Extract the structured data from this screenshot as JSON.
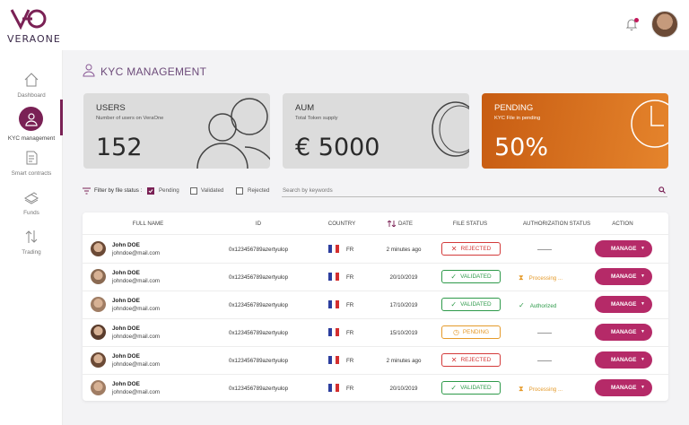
{
  "brand": {
    "name": "VERAONE",
    "accent": "#7a2155"
  },
  "sidebar": {
    "items": [
      {
        "label": "Dashboard",
        "icon": "home-icon"
      },
      {
        "label": "KYC management",
        "icon": "user-icon",
        "active": true
      },
      {
        "label": "Smart contracts",
        "icon": "document-icon"
      },
      {
        "label": "Funds",
        "icon": "funds-icon"
      },
      {
        "label": "Trading",
        "icon": "trading-icon"
      }
    ]
  },
  "page": {
    "title": "KYC MANAGEMENT"
  },
  "cards": [
    {
      "title": "USERS",
      "subtitle": "Number of users on VeraOne",
      "value": "152"
    },
    {
      "title": "AUM",
      "subtitle": "Total Token supply",
      "value": "€ 5000"
    },
    {
      "title": "PENDING",
      "subtitle": "KYC File in pending",
      "value": "50%"
    }
  ],
  "filter": {
    "label": "Filter by file status :",
    "options": [
      {
        "label": "Pending",
        "checked": true
      },
      {
        "label": "Validated",
        "checked": false
      },
      {
        "label": "Rejected",
        "checked": false
      }
    ],
    "search_placeholder": "Search by keywords"
  },
  "table": {
    "headers": [
      "FULL NAME",
      "ID",
      "COUNTRY",
      "DATE",
      "FILE STATUS",
      "AUTHORIZATION STATUS",
      "ACTION"
    ],
    "rows": [
      {
        "name": "John DOE",
        "email": "johndoe@mail.com",
        "id": "0x123456789azertyulop",
        "country": "FR",
        "date": "2 minutes ago",
        "status": "REJECTED",
        "auth": ""
      },
      {
        "name": "John DOE",
        "email": "johndoe@mail.com",
        "id": "0x123456789azertyulop",
        "country": "FR",
        "date": "20/10/2019",
        "status": "VALIDATED",
        "auth": "Processing ..."
      },
      {
        "name": "John DOE",
        "email": "johndoe@mail.com",
        "id": "0x123456789azertyulop",
        "country": "FR",
        "date": "17/10/2019",
        "status": "VALIDATED",
        "auth": "Authorized"
      },
      {
        "name": "John DOE",
        "email": "johndoe@mail.com",
        "id": "0x123456789azertyulop",
        "country": "FR",
        "date": "15/10/2019",
        "status": "PENDING",
        "auth": ""
      },
      {
        "name": "John DOE",
        "email": "johndoe@mail.com",
        "id": "0x123456789azertyulop",
        "country": "FR",
        "date": "2 minutes ago",
        "status": "REJECTED",
        "auth": ""
      },
      {
        "name": "John DOE",
        "email": "johndoe@mail.com",
        "id": "0x123456789azertyulop",
        "country": "FR",
        "date": "20/10/2019",
        "status": "VALIDATED",
        "auth": "Processing ..."
      }
    ],
    "action_label": "MANAGE"
  }
}
